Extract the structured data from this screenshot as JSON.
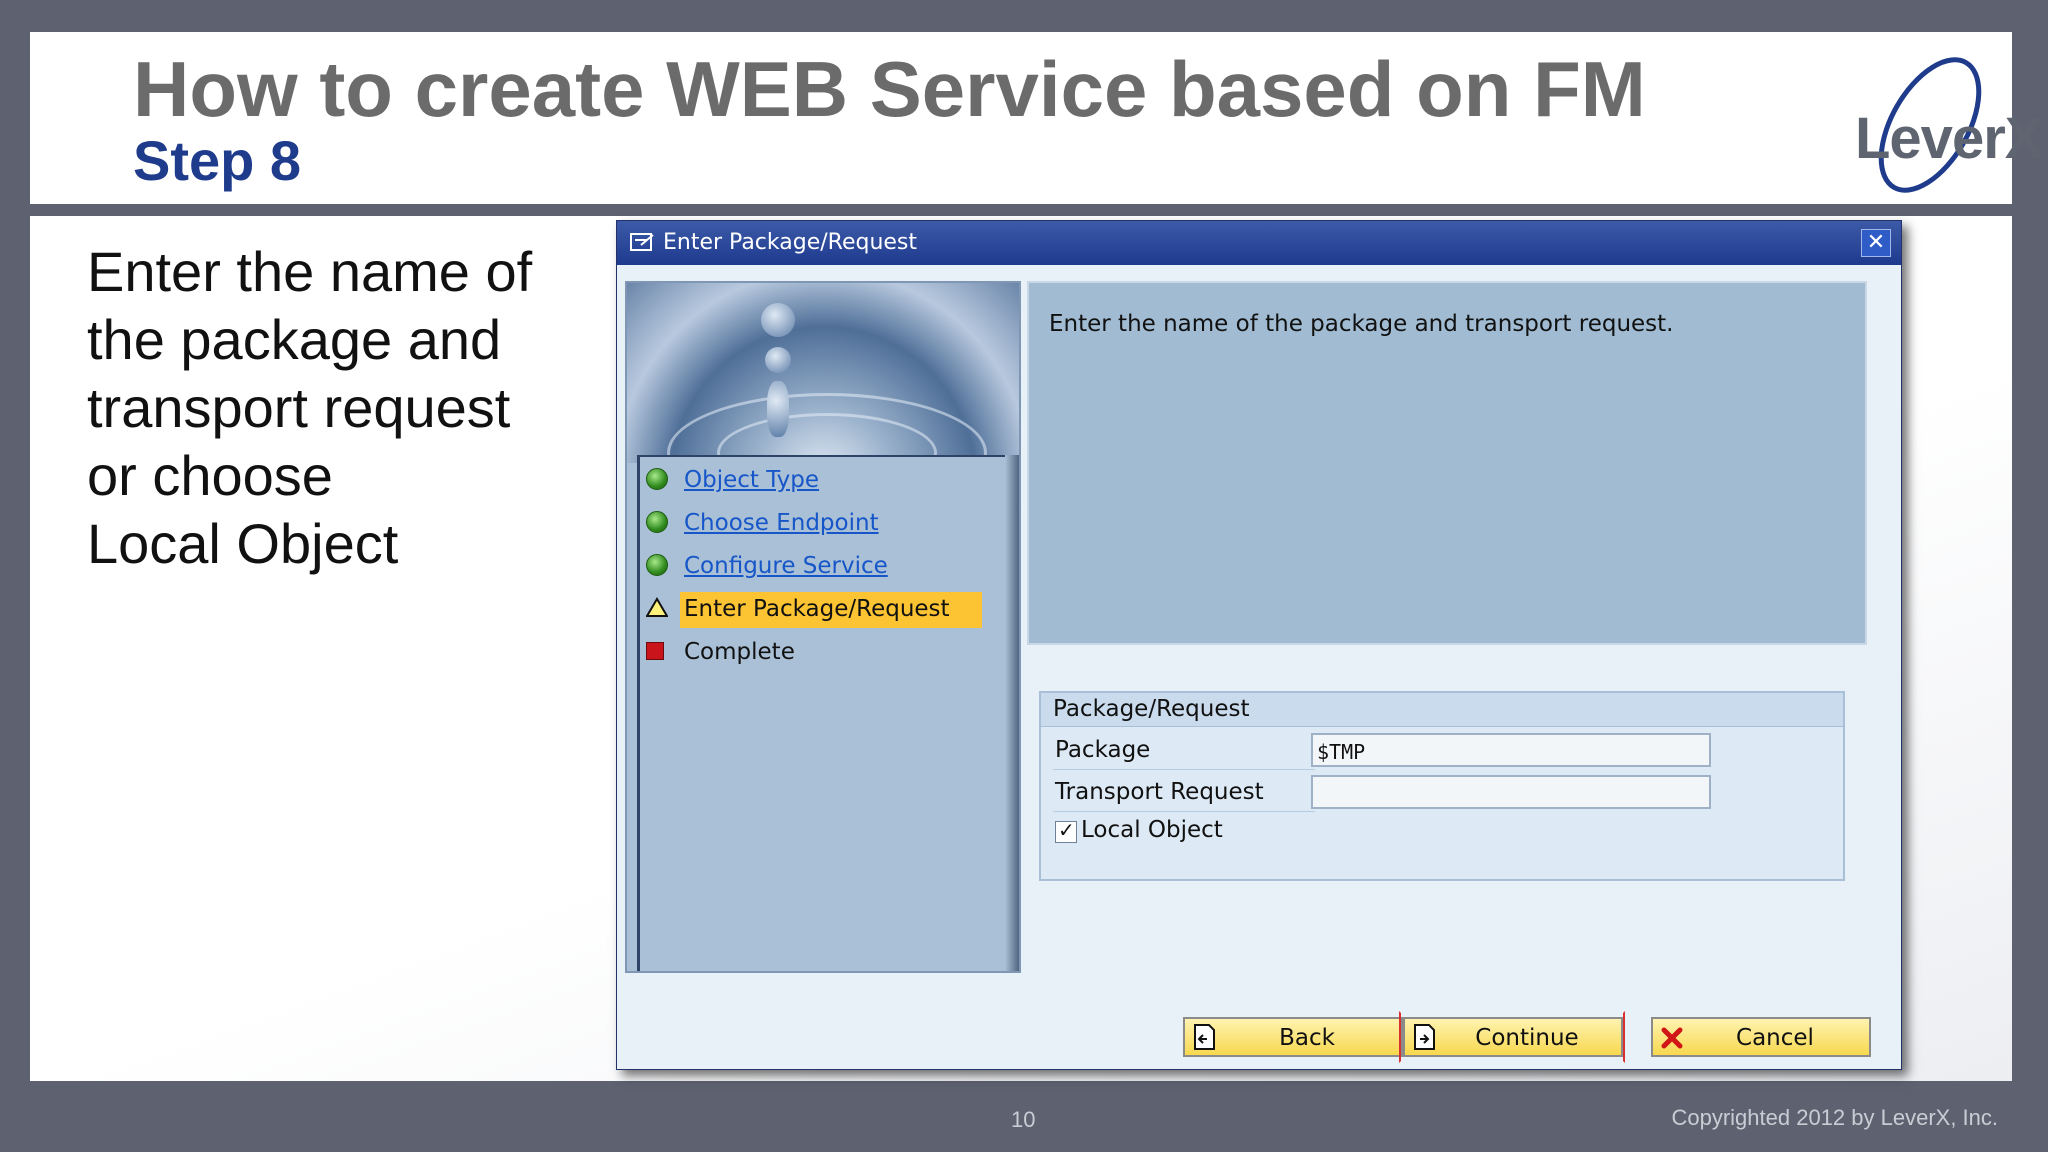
{
  "slide": {
    "title": "How to create WEB Service based on FM",
    "step": "Step 8",
    "instruction": "Enter the name of\nthe package and\ntransport request\nor choose\nLocal Object",
    "page_number": "10",
    "copyright": "Copyrighted 2012 by LeverX, Inc.",
    "logo_text": "LeverX"
  },
  "dialog": {
    "title": "Enter Package/Request",
    "info_text": "Enter the name of the package and transport request.",
    "steps": [
      {
        "label": "Object Type",
        "status": "done",
        "icon": "green-dot-icon"
      },
      {
        "label": "Choose Endpoint",
        "status": "done",
        "icon": "green-dot-icon"
      },
      {
        "label": "Configure Service",
        "status": "done",
        "icon": "green-dot-icon"
      },
      {
        "label": "Enter Package/Request",
        "status": "current",
        "icon": "warning-triangle-icon"
      },
      {
        "label": "Complete",
        "status": "pending",
        "icon": "red-square-icon"
      }
    ],
    "group": {
      "title": "Package/Request",
      "package_label": "Package",
      "package_value": "$TMP",
      "transport_label": "Transport Request",
      "transport_value": "",
      "local_object_label": "Local Object",
      "local_object_checked": true
    },
    "buttons": {
      "back": "Back",
      "continue": "Continue",
      "cancel": "Cancel"
    }
  },
  "colors": {
    "title_gray": "#6b6b6b",
    "step_blue": "#1f3b8c",
    "dialog_title_bar": "#1e3a8e",
    "current_step_highlight": "#fcc332",
    "button_yellow": "#f7d84e"
  }
}
